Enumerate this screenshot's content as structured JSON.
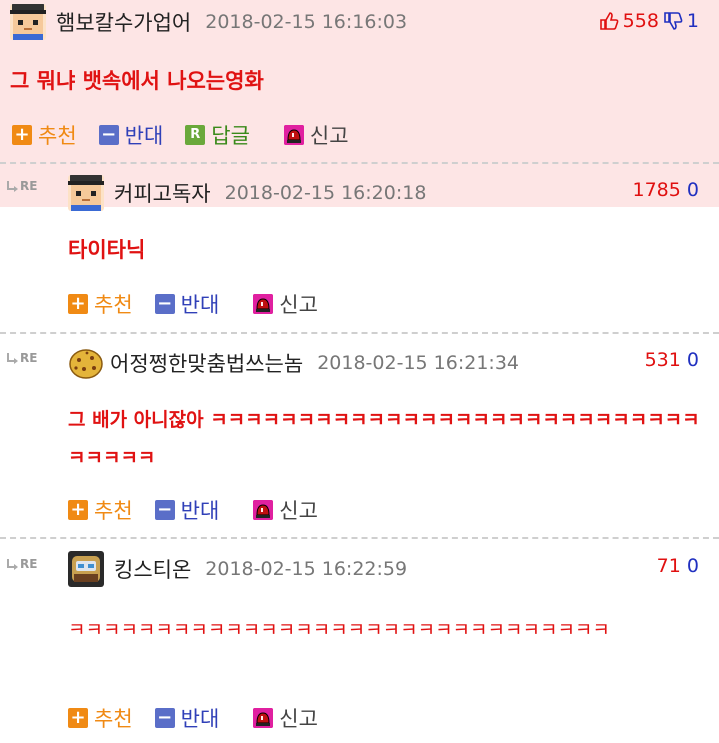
{
  "post": {
    "nick": "햄보칼수가업어",
    "date": "2018-02-15 16:16:03",
    "up": "558",
    "down": "1",
    "body": "그 뭐냐 뱃속에서 나오는영화",
    "actions": {
      "recommend": "추천",
      "oppose": "반대",
      "reply": "답글",
      "report": "신고"
    }
  },
  "re_label": "RE",
  "replies": [
    {
      "nick": "커피고독자",
      "date": "2018-02-15 16:20:18",
      "up": "1785",
      "down": "0",
      "body": "타이타닉",
      "recommend": "추천",
      "oppose": "반대",
      "report": "신고"
    },
    {
      "nick": "어정쩡한맞춤법쓰는놈",
      "date": "2018-02-15 16:21:34",
      "up": "531",
      "down": "0",
      "body": "그 배가 아니잖아 ㅋㅋㅋㅋㅋㅋㅋㅋㅋㅋㅋㅋㅋㅋㅋㅋㅋㅋㅋㅋㅋㅋㅋㅋㅋㅋㅋㅋㅋㅋㅋㅋㅋ",
      "recommend": "추천",
      "oppose": "반대",
      "report": "신고"
    },
    {
      "nick": "킹스티온",
      "date": "2018-02-15 16:22:59",
      "up": "71",
      "down": "0",
      "body": "ㅋㅋㅋㅋㅋㅋㅋㅋㅋㅋㅋㅋㅋㅋㅋㅋㅋㅋㅋㅋㅋㅋㅋㅋㅋㅋㅋㅋㅋㅋㅋ",
      "recommend": "추천",
      "oppose": "반대",
      "report": "신고"
    }
  ],
  "colors": {
    "accent_red": "#e01212",
    "blue": "#2030c0",
    "orange": "#f08a14",
    "top_bg": "#fde5e5"
  },
  "icons": {
    "recommend": "plus-icon",
    "oppose": "minus-icon",
    "reply": "reply-icon",
    "report": "siren-icon",
    "up": "thumbs-up-icon",
    "down": "thumbs-down-icon",
    "reply_arrow": "reply-arrow-icon"
  }
}
